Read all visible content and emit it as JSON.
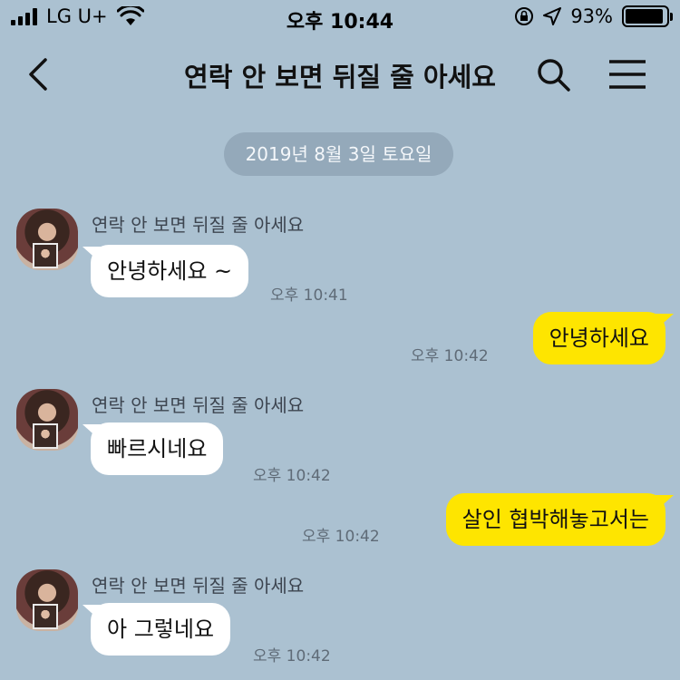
{
  "status_bar": {
    "carrier": "LG U+",
    "time": "오후 10:44",
    "battery": "93%",
    "battery_level": 0.93,
    "icons": [
      "signal-icon",
      "wifi-icon",
      "rotation-lock-icon",
      "location-arrow-icon",
      "battery-icon"
    ]
  },
  "header": {
    "title": "연락 안 보면 뒤질 줄 아세요",
    "icons": [
      "back-arrow-icon",
      "search-icon",
      "menu-icon"
    ]
  },
  "date_divider": "2019년 8월 3일 토요일",
  "messages": [
    {
      "direction": "incoming",
      "sender": "연락 안 보면 뒤질 줄 아세요",
      "text": "안녕하세요 ~",
      "time": "오후 10:41"
    },
    {
      "direction": "outgoing",
      "text": "안녕하세요",
      "time": "오후 10:42"
    },
    {
      "direction": "incoming",
      "sender": "연락 안 보면 뒤질 줄 아세요",
      "text": "빠르시네요",
      "time": "오후 10:42"
    },
    {
      "direction": "outgoing",
      "text": "살인 협박해놓고서는",
      "time": "오후 10:42"
    },
    {
      "direction": "incoming",
      "sender": "연락 안 보면 뒤질 줄 아세요",
      "text": "아 그렇네요",
      "time": "오후 10:42"
    }
  ],
  "colors": {
    "background": "#abc1d1",
    "incoming_bubble": "#ffffff",
    "outgoing_bubble": "#fee500"
  }
}
